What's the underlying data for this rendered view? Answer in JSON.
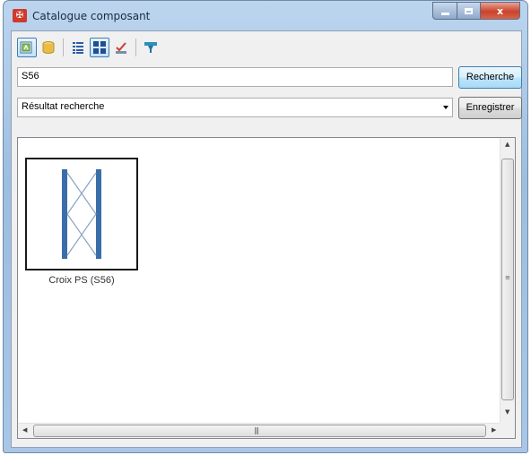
{
  "window": {
    "title": "Catalogue composant",
    "app_icon_glyph": "✠",
    "close_glyph": "x"
  },
  "toolbar": {
    "icons": [
      "library-icon",
      "database-icon",
      "list-view-icon",
      "icon-view-icon",
      "spell-check-icon",
      "filter-icon"
    ],
    "active_view": "icon-view"
  },
  "search": {
    "value": "S56",
    "button_label": "Recherche"
  },
  "results": {
    "selected": "Résultat recherche",
    "save_label": "Enregistrer"
  },
  "items": [
    {
      "label": "Croix PS (S56)",
      "icon": "cross-bracing-frame-icon"
    }
  ],
  "scrollbars": {
    "vertical_grip": "≡",
    "horizontal_grip": "|||",
    "arrow_up": "▲",
    "arrow_down": "▼",
    "arrow_left": "◀",
    "arrow_right": "▶"
  },
  "colors": {
    "frame_blue": "#3b6ea8",
    "accent": "#3c7fb1"
  }
}
